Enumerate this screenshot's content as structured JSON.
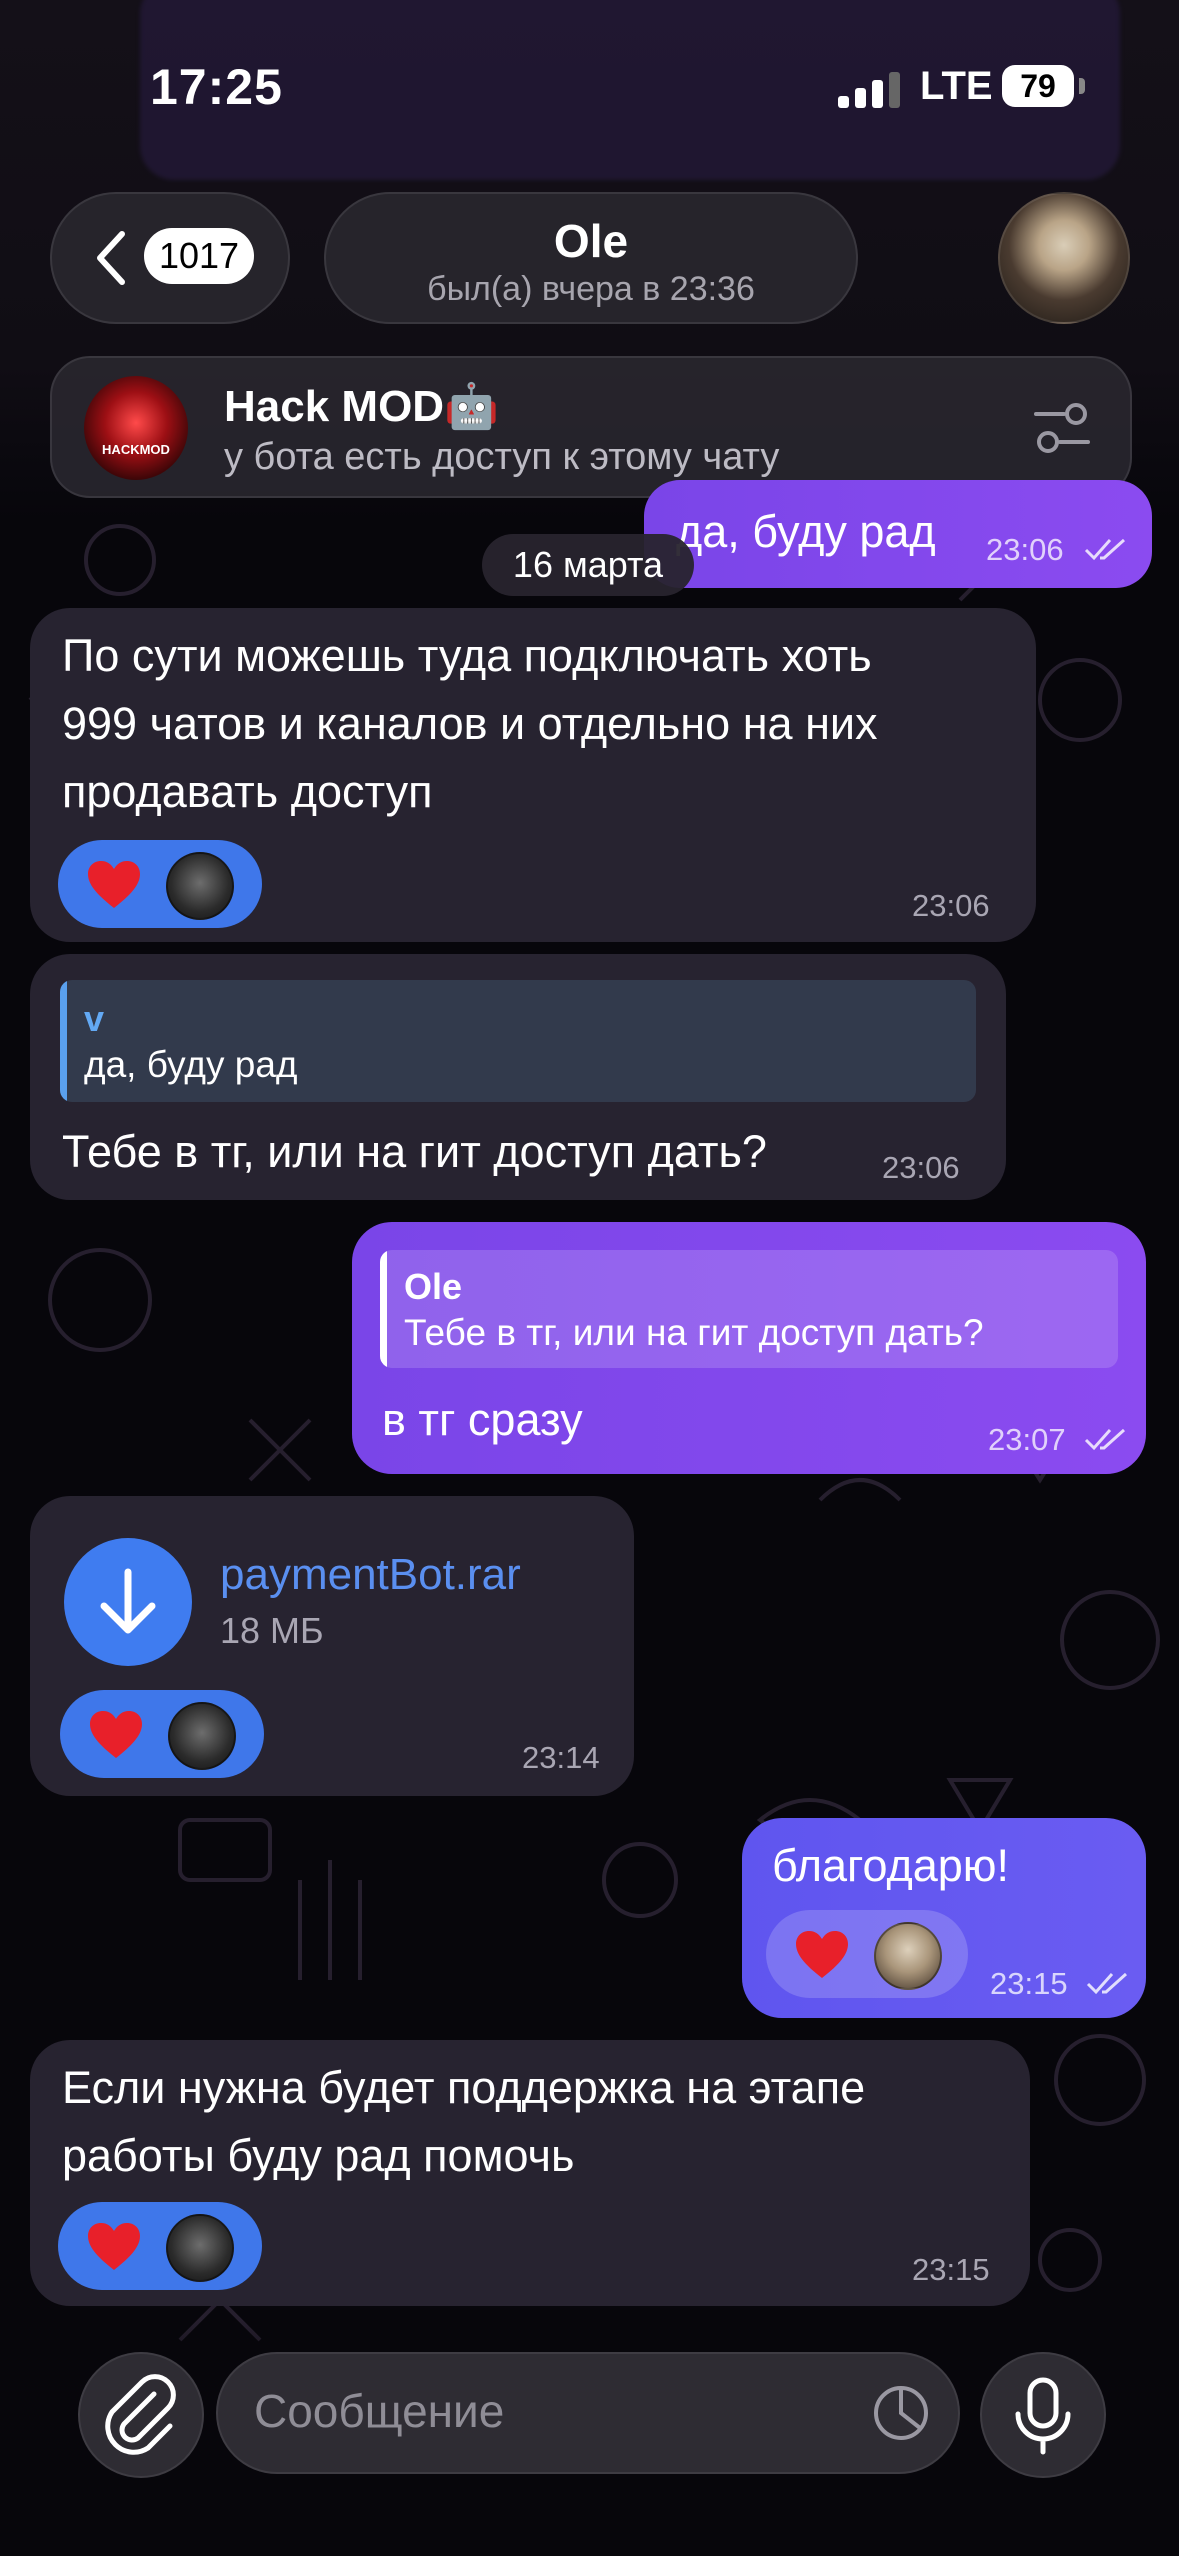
{
  "status_bar": {
    "time": "17:25",
    "network": "LTE",
    "battery": "79"
  },
  "header": {
    "back_count": "1017",
    "chat_name": "Ole",
    "last_seen": "был(а) вчера в 23:36"
  },
  "bot_banner": {
    "name": "Hack MOD🤖",
    "subtitle": "у бота есть доступ к этому чату",
    "logo_text": "HACKMOD"
  },
  "date_separator": "16 марта",
  "messages": [
    {
      "direction": "out",
      "text": "да, буду рад",
      "time": "23:06",
      "status": "read"
    },
    {
      "direction": "in",
      "text": "По сути можешь туда подключать хоть\n999 чатов и каналов и отдельно на них\nпродавать доступ",
      "time": "23:06",
      "reaction": "❤️"
    },
    {
      "direction": "in",
      "reply_to": {
        "name": "v",
        "text": "да, буду рад"
      },
      "text": "Тебе в тг, или на гит доступ дать?",
      "time": "23:06"
    },
    {
      "direction": "out",
      "reply_to": {
        "name": "Ole",
        "text": "Тебе в тг, или на гит доступ дать?"
      },
      "text": "в тг сразу",
      "time": "23:07",
      "status": "read"
    },
    {
      "direction": "in",
      "file": {
        "name": "paymentBot.rar",
        "size": "18 МБ"
      },
      "time": "23:14",
      "reaction": "❤️"
    },
    {
      "direction": "out",
      "text": "благодарю!",
      "time": "23:15",
      "status": "read",
      "reaction": "❤️"
    },
    {
      "direction": "in",
      "text": "Если нужна будет поддержка на этапе\nработы буду рад помочь",
      "time": "23:15",
      "reaction": "❤️"
    }
  ],
  "input": {
    "placeholder": "Сообщение"
  },
  "colors": {
    "accent_out": "#8b4bf0",
    "reaction_in": "#3f77ea",
    "file_link": "#5a8ff0",
    "background": "#07060b"
  }
}
